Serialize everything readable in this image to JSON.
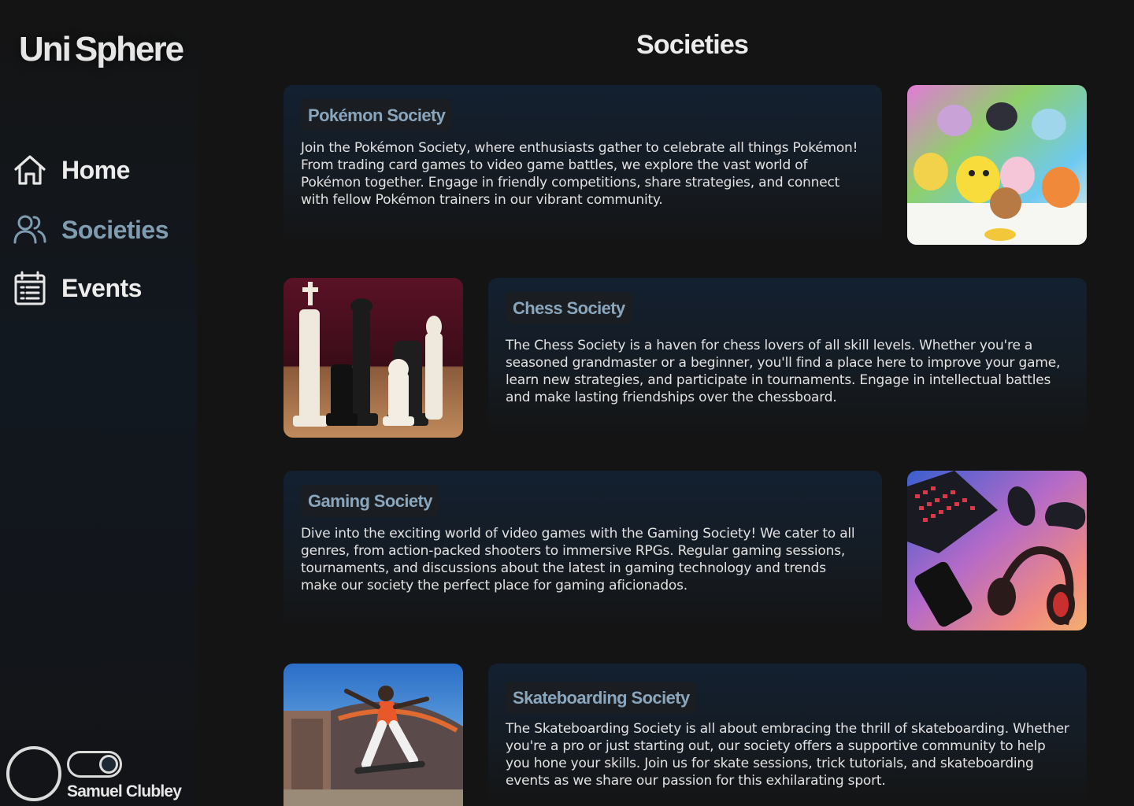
{
  "app": {
    "logo_part1": "Uni",
    "logo_part2": "Sphere"
  },
  "sidebar": {
    "items": [
      {
        "label": "Home",
        "icon": "home-icon",
        "active": false
      },
      {
        "label": "Societies",
        "icon": "users-icon",
        "active": true
      },
      {
        "label": "Events",
        "icon": "calendar-icon",
        "active": false
      }
    ]
  },
  "user": {
    "name": "Samuel Clubley",
    "theme_toggle_on": true
  },
  "page": {
    "title": "Societies"
  },
  "societies": [
    {
      "name": "Pokémon Society",
      "description": "Join the Pokémon Society, where enthusiasts gather to celebrate all things Pokémon! From trading card games to video game battles, we explore the vast world of Pokémon together. Engage in friendly competitions, share strategies, and connect with fellow Pokémon trainers in our vibrant community.",
      "image": "pokemon-image",
      "image_side": "right"
    },
    {
      "name": "Chess Society",
      "description": "The Chess Society is a haven for chess lovers of all skill levels. Whether you're a seasoned grandmaster or a beginner, you'll find a place here to improve your game, learn new strategies, and participate in tournaments. Engage in intellectual battles and make lasting friendships over the chessboard.",
      "image": "chess-image",
      "image_side": "left"
    },
    {
      "name": "Gaming Society",
      "description": "Dive into the exciting world of video games with the Gaming Society! We cater to all genres, from action-packed shooters to immersive RPGs. Regular gaming sessions, tournaments, and discussions about the latest in gaming technology and trends make our society the perfect place for gaming aficionados.",
      "image": "gaming-image",
      "image_side": "right"
    },
    {
      "name": "Skateboarding Society",
      "description": "The Skateboarding Society is all about embracing the thrill of skateboarding. Whether you're a pro or just starting out, our society offers a supportive community to help you hone your skills. Join us for skate sessions, trick tutorials, and skateboarding events as we share our passion for this exhilarating sport.",
      "image": "skateboarding-image",
      "image_side": "left"
    }
  ],
  "colors": {
    "background": "#141414",
    "accent": "#7f9cb0",
    "card_title": "#8aa6bd",
    "card_bg_top": "#132030"
  }
}
